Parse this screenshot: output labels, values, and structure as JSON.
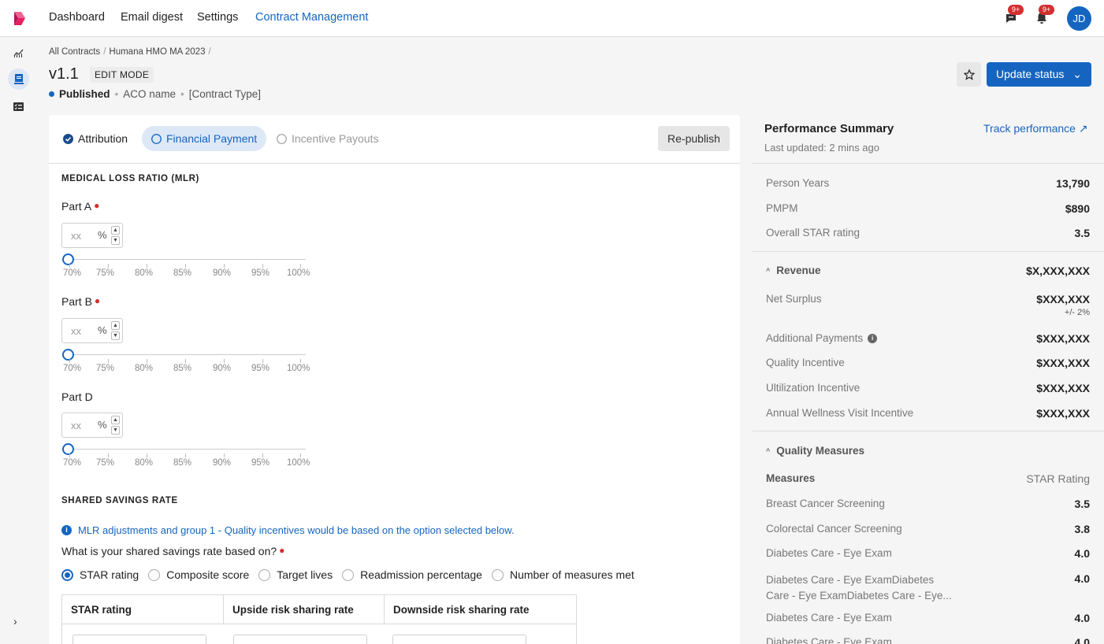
{
  "nav": {
    "links": [
      "Dashboard",
      "Email digest",
      "Settings",
      "Contract Management"
    ],
    "active": "Contract Management",
    "messages_badge": "9+",
    "notifications_badge": "9+",
    "avatar": "JD"
  },
  "breadcrumb": {
    "root": "All Contracts",
    "current": "Humana HMO MA 2023",
    "sep": "/"
  },
  "header": {
    "version": "v1.1",
    "mode": "EDIT MODE",
    "status": "Published",
    "aco": "ACO name",
    "contract_type": "[Contract Type]",
    "update_button": "Update status",
    "chevron": "⌄"
  },
  "tabs": {
    "attribution": "Attribution",
    "financial": "Financial Payment",
    "incentive": "Incentive Payouts",
    "republish": "Re-publish"
  },
  "mlr": {
    "heading": "MEDICAL LOSS RATIO (MLR)",
    "parts": [
      {
        "label": "Part A",
        "required": true,
        "placeholder": "xx",
        "unit": "%"
      },
      {
        "label": "Part B",
        "required": true,
        "placeholder": "xx",
        "unit": "%"
      },
      {
        "label": "Part D",
        "required": false,
        "placeholder": "xx",
        "unit": "%"
      }
    ],
    "ticks": [
      "70%",
      "75%",
      "80%",
      "85%",
      "90%",
      "95%",
      "100%"
    ]
  },
  "shared": {
    "heading": "SHARED SAVINGS RATE",
    "info": "MLR adjustments and group 1 - Quality incentives would be based on the option selected below.",
    "question": "What is your shared savings rate based on?",
    "options": [
      "STAR rating",
      "Composite score",
      "Target lives",
      "Readmission percentage",
      "Number of measures met"
    ],
    "selected": "STAR rating",
    "table_headers": [
      "STAR rating",
      "Upside risk sharing rate",
      "Downside risk sharing rate"
    ]
  },
  "summary": {
    "title": "Performance Summary",
    "updated": "Last updated: 2 mins ago",
    "track": "Track performance",
    "track_icon": "↗",
    "metrics": [
      {
        "label": "Person Years",
        "value": "13,790"
      },
      {
        "label": "PMPM",
        "value": "$890"
      },
      {
        "label": "Overall STAR rating",
        "value": "3.5"
      }
    ],
    "revenue": {
      "label": "Revenue",
      "value": "$X,XXX,XXX",
      "net_label": "Net Surplus",
      "net_value": "$XXX,XXX",
      "net_sub": "+/- 2%",
      "items": [
        {
          "label": "Additional Payments",
          "value": "$XXX,XXX"
        },
        {
          "label": "Quality Incentive",
          "value": "$XXX,XXX"
        },
        {
          "label": "Ultilization Incentive",
          "value": "$XXX,XXX"
        },
        {
          "label": "Annual Wellness Visit Incentive",
          "value": "$XXX,XXX"
        }
      ]
    },
    "quality": {
      "label": "Quality Measures",
      "col1": "Measures",
      "col2": "STAR Rating",
      "items": [
        {
          "label": "Breast Cancer Screening",
          "value": "3.5"
        },
        {
          "label": "Colorectal Cancer Screening",
          "value": "3.8"
        },
        {
          "label": "Diabetes Care - Eye Exam",
          "value": "4.0"
        },
        {
          "label": "Diabetes Care - Eye ExamDiabetes Care - Eye ExamDiabetes Care - Eye...",
          "value": "4.0"
        },
        {
          "label": "Diabetes Care - Eye Exam",
          "value": "4.0"
        },
        {
          "label": "Diabetes Care - Eye Exam",
          "value": "4.0"
        }
      ]
    }
  }
}
